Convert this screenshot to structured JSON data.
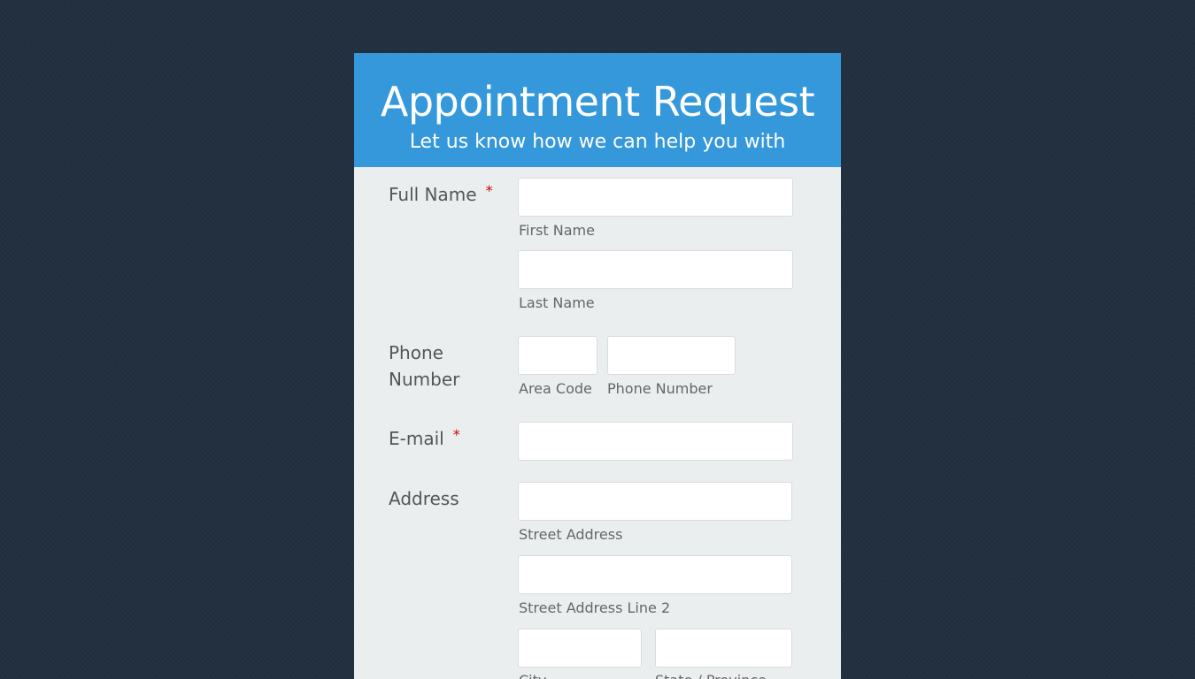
{
  "header": {
    "title": "Appointment Request",
    "subtitle": "Let us know how we can help you with"
  },
  "fields": {
    "full_name": {
      "label": "Full Name",
      "required_mark": "*",
      "first": {
        "value": "",
        "sublabel": "First Name"
      },
      "last": {
        "value": "",
        "sublabel": "Last Name"
      }
    },
    "phone": {
      "label_line1": "Phone",
      "label_line2": "Number",
      "area": {
        "value": "",
        "sublabel": "Area Code"
      },
      "number": {
        "value": "",
        "sublabel": "Phone Number"
      }
    },
    "email": {
      "label": "E-mail",
      "required_mark": "*",
      "value": ""
    },
    "address": {
      "label": "Address",
      "street": {
        "value": "",
        "sublabel": "Street Address"
      },
      "street2": {
        "value": "",
        "sublabel": "Street Address Line 2"
      },
      "city": {
        "value": "",
        "sublabel": "City"
      },
      "state": {
        "value": "",
        "sublabel": "State / Province"
      }
    }
  },
  "colors": {
    "page_background": "#22303f",
    "header_background": "#3498db",
    "form_background": "#ebeeef",
    "required": "#d00000"
  }
}
